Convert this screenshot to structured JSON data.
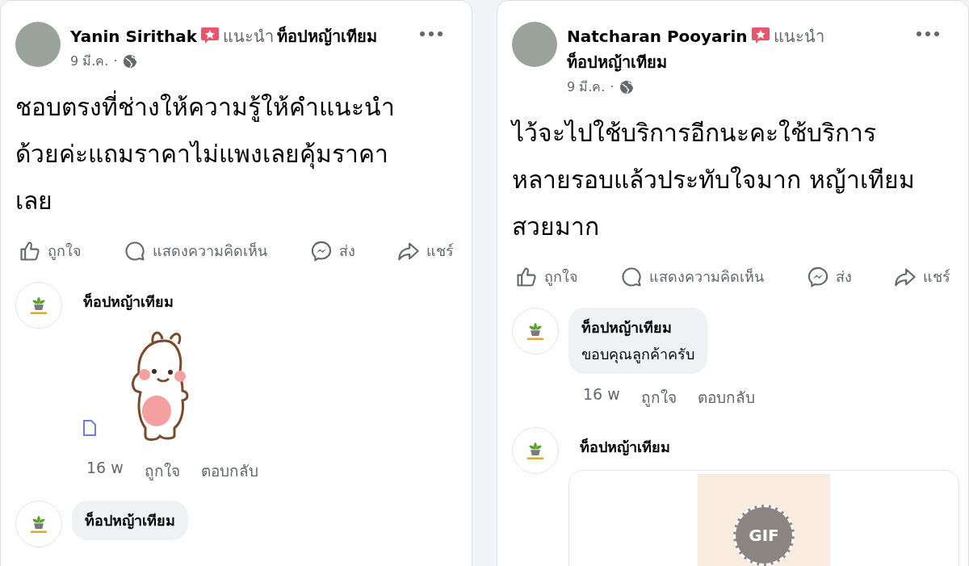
{
  "posts": [
    {
      "author": "Yanin Sirithak",
      "recommends": "แนะนำ",
      "page": "ท็อปหญ้าเทียม",
      "date": "9 มี.ค.",
      "separator": "·",
      "body": "ชอบตรงที่ช่างให้ความรู้ให้คำแนะนำด้วยค่ะแถมราคาไม่แพงเลยคุ้มราคาเลย",
      "actions": [
        {
          "kind": "like",
          "label": "ถูกใจ"
        },
        {
          "kind": "comment",
          "label": "แสดงความคิดเห็น"
        },
        {
          "kind": "send",
          "label": "ส่ง"
        },
        {
          "kind": "share",
          "label": "แชร์"
        }
      ],
      "comments": [
        {
          "kind": "sticker",
          "name": "ท็อปหญ้าเทียม",
          "time": "16 w",
          "like": "ถูกใจ",
          "reply": "ตอบกลับ"
        },
        {
          "kind": "text",
          "name": "ท็อปหญ้าเทียม"
        }
      ]
    },
    {
      "author": "Natcharan Pooyarin",
      "recommends": "แนะนำ",
      "page": "ท็อปหญ้าเทียม",
      "date": "9 มี.ค.",
      "separator": "·",
      "body": "ไว้จะไปใช้บริการอีกนะคะใช้บริการหลายรอบแล้วประทับใจมาก หญ้าเทียมสวยมาก",
      "actions": [
        {
          "kind": "like",
          "label": "ถูกใจ"
        },
        {
          "kind": "comment",
          "label": "แสดงความคิดเห็น"
        },
        {
          "kind": "send",
          "label": "ส่ง"
        },
        {
          "kind": "share",
          "label": "แชร์"
        }
      ],
      "comments": [
        {
          "kind": "text",
          "name": "ท็อปหญ้าเทียม",
          "text": "ขอบคุณลูกค้าครับ",
          "time": "16 w",
          "like": "ถูกใจ",
          "reply": "ตอบกลับ"
        },
        {
          "kind": "gif",
          "name": "ท็อปหญ้าเทียม",
          "badge": "GIF"
        }
      ]
    }
  ]
}
